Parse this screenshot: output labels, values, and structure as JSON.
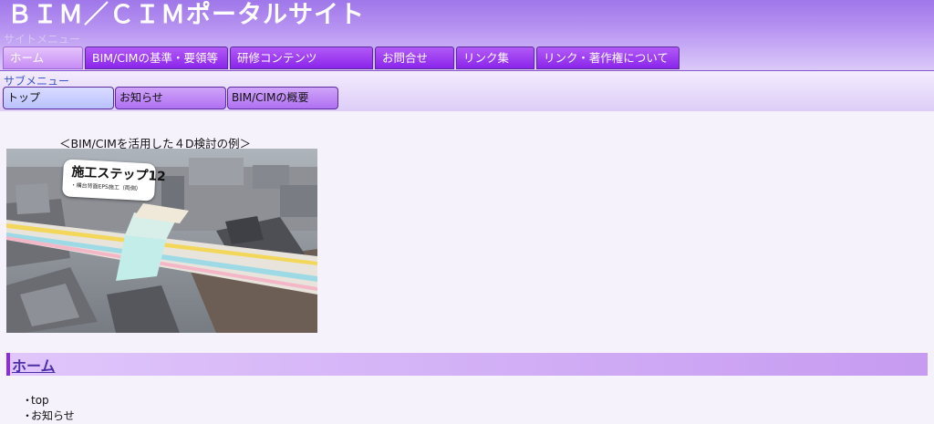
{
  "header": {
    "site_title": "ＢＩＭ／ＣＩＭポータルサイト",
    "site_menu_label": "サイトメニュー"
  },
  "main_nav": {
    "items": [
      {
        "label": "ホーム",
        "active": true
      },
      {
        "label": "BIM/CIMの基準・要領等",
        "active": false
      },
      {
        "label": "研修コンテンツ",
        "active": false
      },
      {
        "label": "お問合せ",
        "active": false
      },
      {
        "label": "リンク集",
        "active": false
      },
      {
        "label": "リンク・著作権について",
        "active": false
      }
    ]
  },
  "sub_nav": {
    "label": "サブメニュー",
    "items": [
      {
        "label": "トップ",
        "active": true
      },
      {
        "label": "お知らせ",
        "active": false
      },
      {
        "label": "BIM/CIMの概要",
        "active": false
      }
    ]
  },
  "content": {
    "caption": "＜BIM/CIMを活用した４D検討の例＞",
    "image": {
      "sign_title": "施工ステップ12",
      "sign_subtitle": "・構台背面EPS施工（両側）"
    },
    "section_heading": "ホーム",
    "list_items": [
      {
        "bullet": "・",
        "text": "top"
      },
      {
        "bullet": "・",
        "text": "お知らせ"
      }
    ]
  },
  "colors": {
    "tab_purple": "#8a25ea",
    "active_tab_pink": "#e6c3fc",
    "active_subtab_blue": "#b9c1ff",
    "section_accent": "#8b2be2",
    "sub_menu_label_blue": "#3b56cc"
  }
}
